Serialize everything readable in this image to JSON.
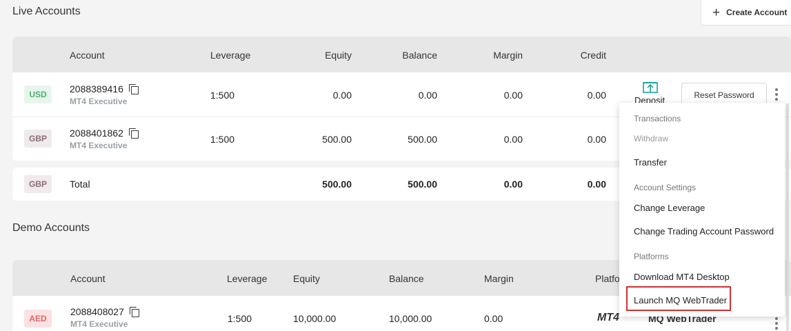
{
  "live": {
    "title": "Live Accounts",
    "create_label": "Create Account",
    "headers": [
      "Account",
      "Leverage",
      "Equity",
      "Balance",
      "Margin",
      "Credit"
    ],
    "rows": [
      {
        "currency": "USD",
        "account": "2088389416",
        "type": "MT4 Executive",
        "leverage": "1:500",
        "equity": "0.00",
        "balance": "0.00",
        "margin": "0.00",
        "credit": "0.00"
      },
      {
        "currency": "GBP",
        "account": "2088401862",
        "type": "MT4 Executive",
        "leverage": "1:500",
        "equity": "500.00",
        "balance": "500.00",
        "margin": "0.00",
        "credit": "0.00"
      }
    ],
    "total": {
      "currency": "GBP",
      "label": "Total",
      "equity": "500.00",
      "balance": "500.00",
      "margin": "0.00",
      "credit": "0.00"
    },
    "deposit_label": "Deposit",
    "reset_label": "Reset Password"
  },
  "demo": {
    "title": "Demo Accounts",
    "headers": [
      "Account",
      "Leverage",
      "Equity",
      "Balance",
      "Margin",
      "Platfo"
    ],
    "rows": [
      {
        "currency": "AED",
        "account": "2088408027",
        "type": "MT4 Executive",
        "leverage": "1:500",
        "equity": "10,000.00",
        "balance": "10,000.00",
        "margin": "0.00",
        "platform": "MT4",
        "webtrader": "MQ WebTrader"
      }
    ]
  },
  "menu": {
    "transactions_header": "Transactions",
    "withdraw": "Withdraw",
    "transfer": "Transfer",
    "settings_header": "Account Settings",
    "change_leverage": "Change Leverage",
    "change_password": "Change Trading Account Password",
    "platforms_header": "Platforms",
    "download": "Download MT4 Desktop",
    "launch": "Launch MQ WebTrader"
  },
  "colors": {
    "highlight": "#d32f2f",
    "deposit_icon": "#1aa39a"
  }
}
